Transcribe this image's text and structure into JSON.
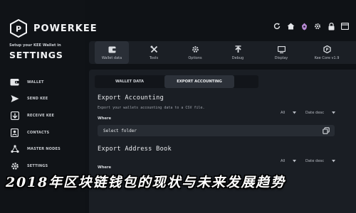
{
  "brand": {
    "name": "POWERKEE"
  },
  "sidebar": {
    "setup_caption": "Setup your KEE Wallet in",
    "page_heading": "SETTINGS",
    "items": [
      {
        "label": "WALLET",
        "icon": "wallet-icon"
      },
      {
        "label": "SEND KEE",
        "icon": "send-icon"
      },
      {
        "label": "RECEIVE KEE",
        "icon": "receive-icon"
      },
      {
        "label": "CONTACTS",
        "icon": "contacts-icon"
      },
      {
        "label": "MASTER NODES",
        "icon": "masternodes-icon"
      },
      {
        "label": "SETTINGS",
        "icon": "settings-icon"
      }
    ]
  },
  "top_icons": [
    "refresh-icon",
    "home-icon",
    "wallet-status-icon",
    "settings-icon",
    "lock-icon",
    "window-icon"
  ],
  "tabs": [
    {
      "label": "Wallet data",
      "icon": "wallet-data-icon",
      "active": true
    },
    {
      "label": "Tools",
      "icon": "tools-icon",
      "active": false
    },
    {
      "label": "Options",
      "icon": "options-icon",
      "active": false
    },
    {
      "label": "Debug",
      "icon": "debug-icon",
      "active": false
    },
    {
      "label": "Display",
      "icon": "display-icon",
      "active": false
    },
    {
      "label": "Kee Core v1.9",
      "icon": "core-icon",
      "active": false
    }
  ],
  "subtabs": [
    {
      "label": "WALLET DATA",
      "active": false
    },
    {
      "label": "EXPORT ACCOUNTING",
      "active": true
    }
  ],
  "export_accounting": {
    "title": "Export Accounting",
    "description": "Export your wallets accounting data to a CSV file.",
    "where_label": "Where",
    "filter_all": "All",
    "sort": "Date desc",
    "folder_placeholder": "Select folder"
  },
  "export_address_book": {
    "title": "Export Address Book",
    "where_label": "Where",
    "filter_all": "All",
    "sort": "Date desc"
  },
  "overlay_caption": "2018年区块链钱包的现状与未来发展趋势",
  "colors": {
    "background": "#0f1216",
    "panel": "#1a1e24",
    "tabbar": "#1b1f25",
    "active_tab": "#2a2f37",
    "accent_purple": "#b98ad6"
  }
}
